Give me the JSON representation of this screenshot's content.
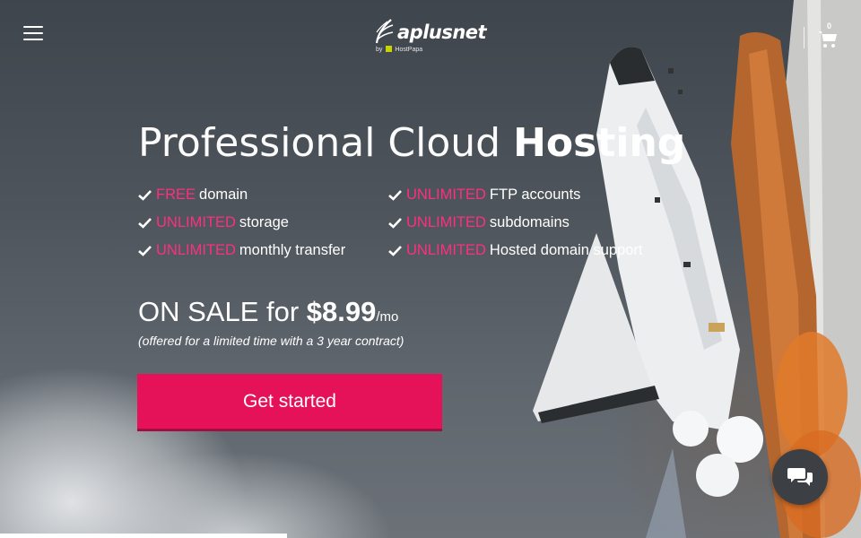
{
  "header": {
    "menu_icon": "hamburger-menu-icon",
    "logo": {
      "name": "aplusnet",
      "by_text": "by",
      "partner": "HostPapa"
    },
    "cart": {
      "icon": "shopping-cart-icon",
      "count": "0"
    }
  },
  "hero": {
    "headline_light": "Professional Cloud ",
    "headline_bold": "Hosting",
    "features": [
      {
        "highlight": "FREE",
        "text": "domain"
      },
      {
        "highlight": "UNLIMITED",
        "text": "storage"
      },
      {
        "highlight": "UNLIMITED",
        "text": "monthly transfer"
      },
      {
        "highlight": "UNLIMITED",
        "text": "FTP accounts"
      },
      {
        "highlight": "UNLIMITED",
        "text": "subdomains"
      },
      {
        "highlight": "UNLIMITED",
        "text": "Hosted domain support"
      }
    ],
    "price": {
      "prefix": "ON SALE for ",
      "amount": "$8.99",
      "unit": "/mo"
    },
    "note": "(offered for a limited time with a 3 year contract)",
    "cta_label": "Get started"
  },
  "chat": {
    "icon": "chat-bubbles-icon"
  },
  "colors": {
    "accent": "#e5125a",
    "highlight": "#ff2f7d",
    "chat_bg": "#3c3f44"
  }
}
